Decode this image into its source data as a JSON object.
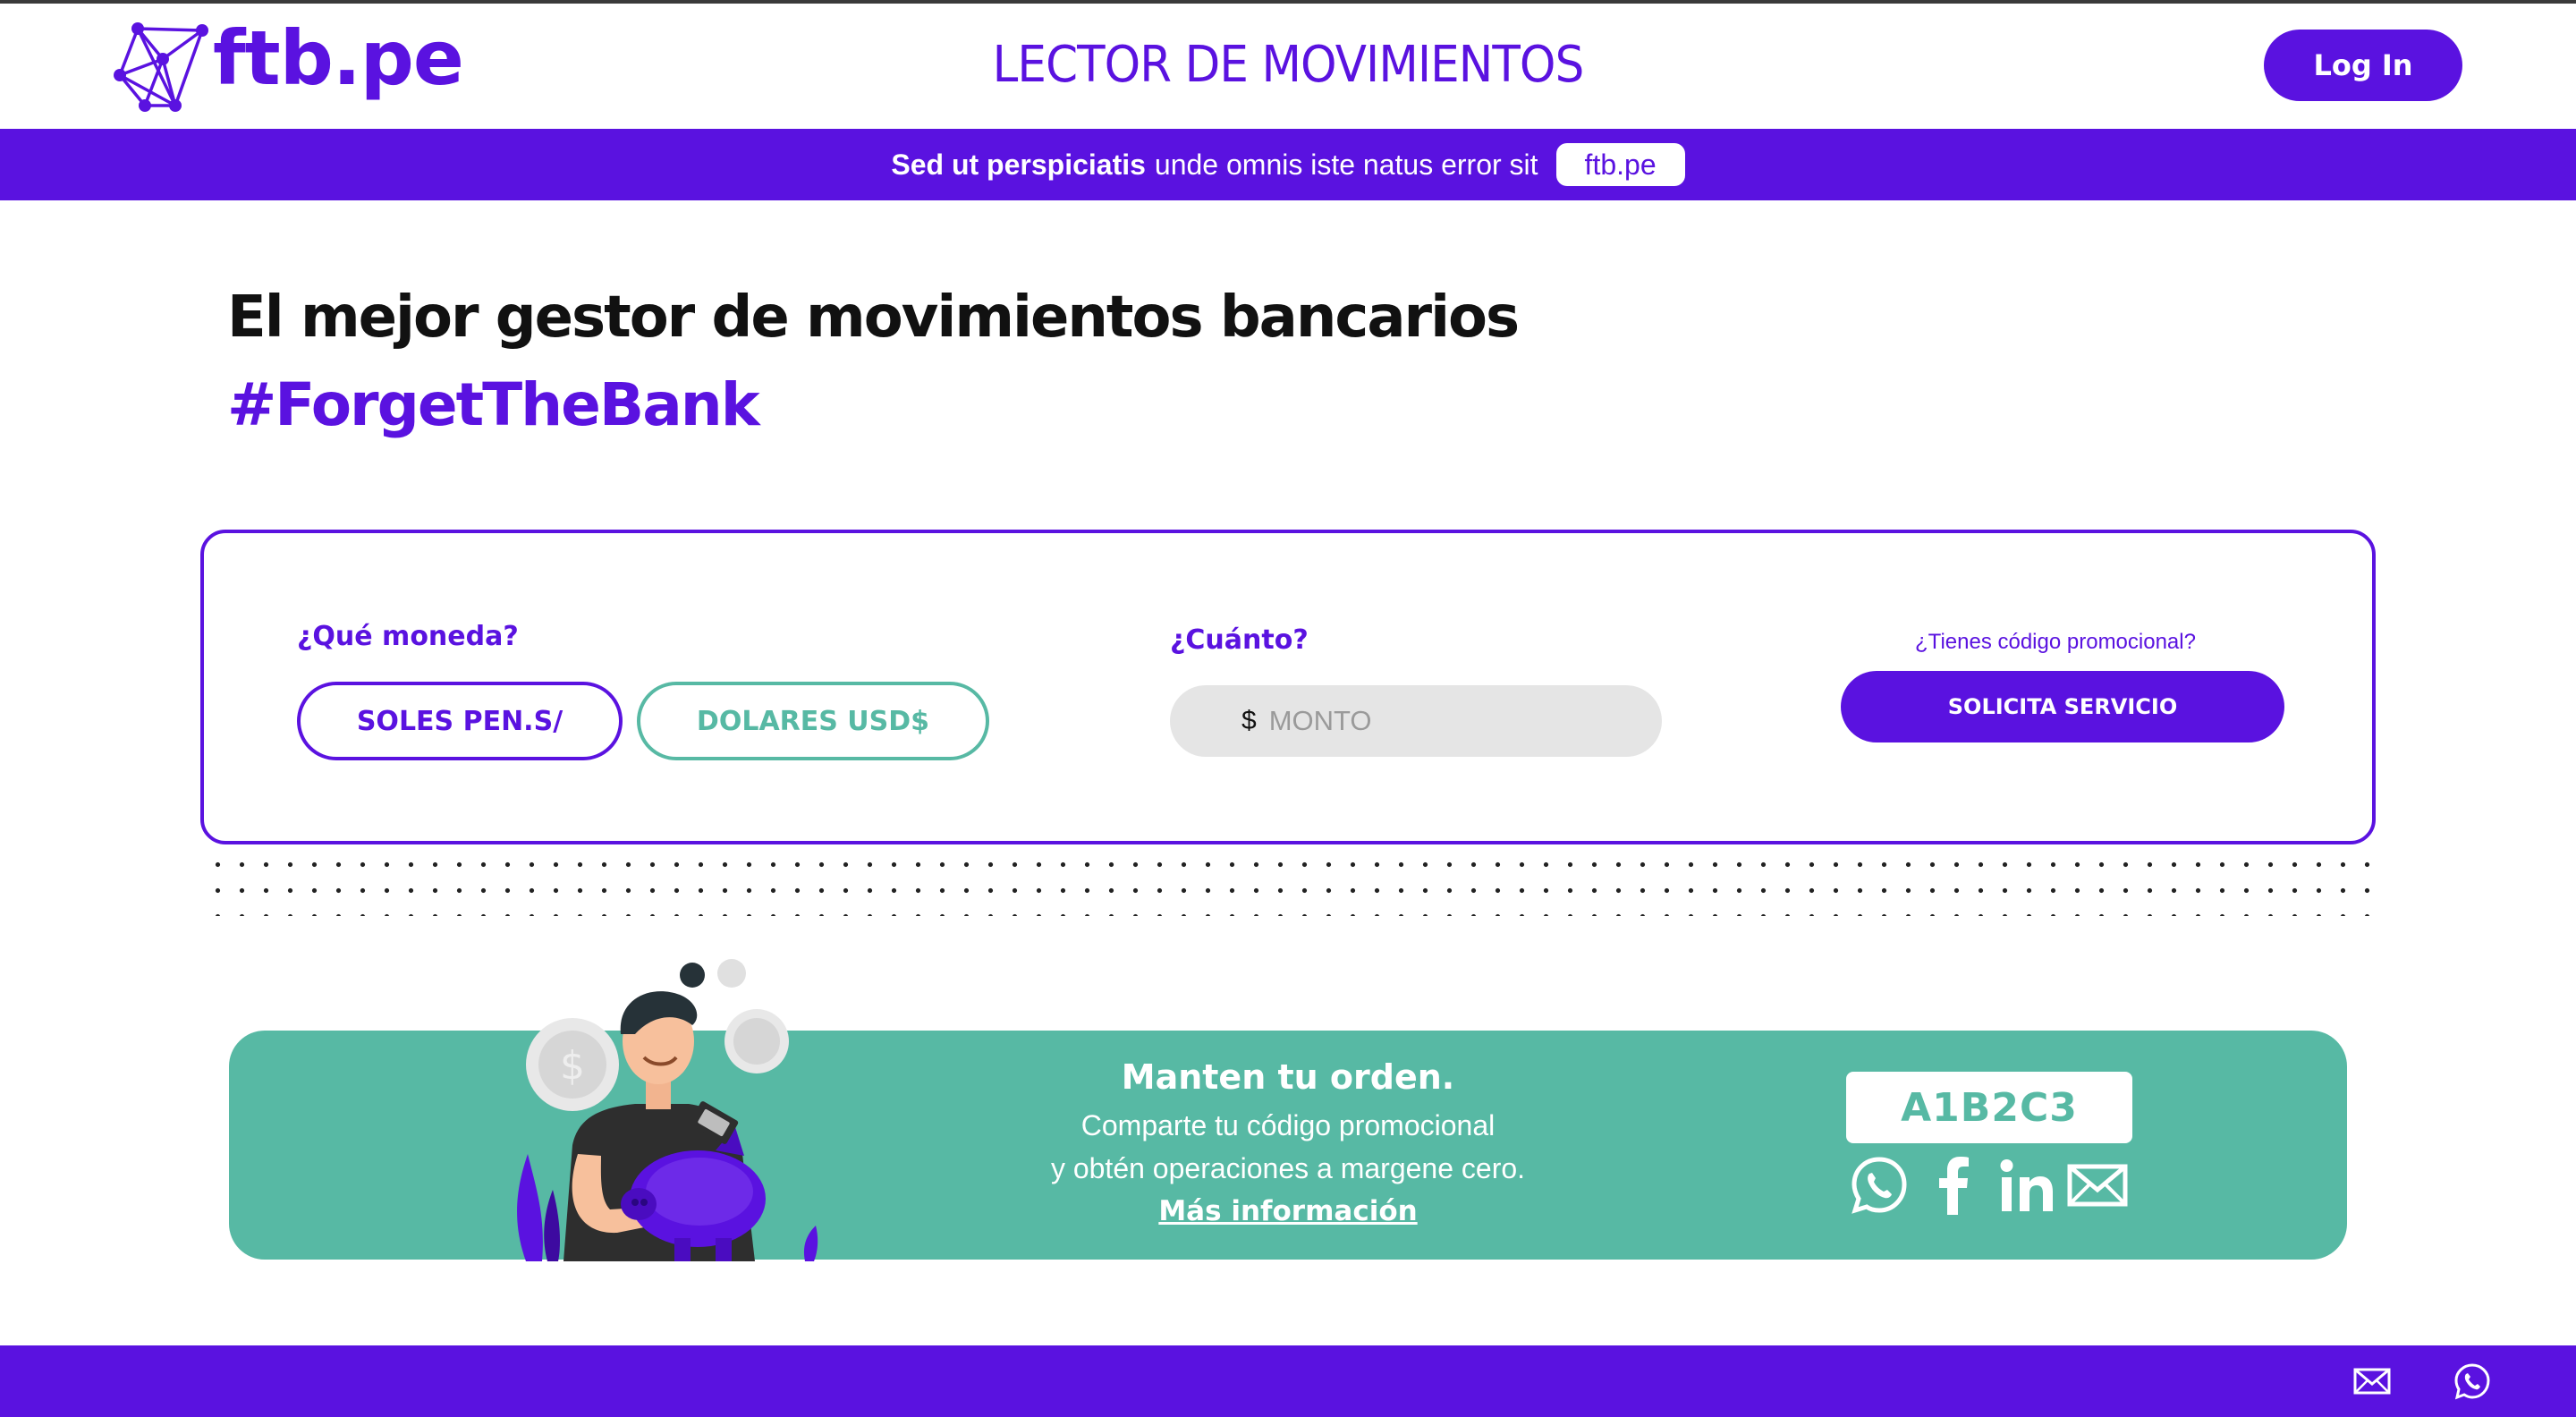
{
  "header": {
    "logo_text": "ftb.pe",
    "title": "LECTOR DE MOVIMIENTOS",
    "login_label": "Log In"
  },
  "banner": {
    "bold": "Sed ut perspiciatis",
    "rest": "unde omnis iste natus error sit",
    "pill": "ftb.pe"
  },
  "hero": {
    "title": "El mejor gestor de movimientos bancarios",
    "hashtag": "#ForgetTheBank"
  },
  "form": {
    "currency_label": "¿Qué moneda?",
    "soles_label": "SOLES PEN.S/",
    "dolares_label": "DOLARES USD$",
    "amount_label": "¿Cuánto?",
    "amount_symbol": "$",
    "amount_placeholder": "MONTO",
    "promo_question": "¿Tienes código promocional?",
    "submit_label": "SOLICITA SERVICIO"
  },
  "promo": {
    "title": "Manten tu orden.",
    "line1": "Comparte tu código promocional",
    "line2": "y obtén operaciones a margene cero.",
    "link": "Más información",
    "code": "A1B2C3",
    "share_icons": [
      "whatsapp-icon",
      "facebook-icon",
      "linkedin-icon",
      "mail-icon"
    ]
  },
  "footer": {
    "icons": [
      "mail-icon",
      "whatsapp-icon"
    ]
  },
  "colors": {
    "primary": "#5a12e0",
    "teal": "#57b9a4",
    "input_bg": "#e5e5e5"
  }
}
